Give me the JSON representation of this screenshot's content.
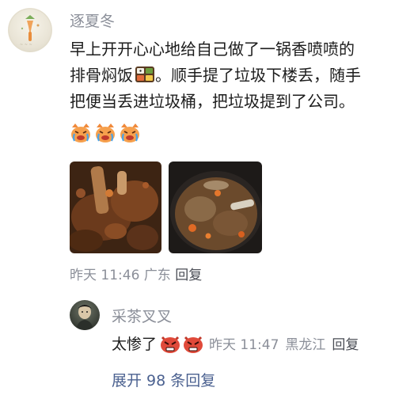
{
  "comment": {
    "username": "逐夏冬",
    "text_line1": "早上开开心心地给自己做了一锅香喷喷的",
    "text_line2_a": "排骨焖饭",
    "text_line2_b": "。顺手提了垃圾下楼丢，随手",
    "text_line3": "把便当丢进垃圾桶，把垃圾提到了公司。",
    "emojis": [
      "crying-cat-emoji",
      "crying-cat-emoji",
      "crying-cat-emoji"
    ],
    "photos": [
      "rib-stew-photo-1",
      "rib-stew-photo-2"
    ],
    "time": "昨天 11:46",
    "location": "广东",
    "reply_label": "回复"
  },
  "reply": {
    "username": "采茶叉叉",
    "text": "太惨了",
    "emojis": [
      "angry-face-emoji",
      "angry-face-emoji"
    ],
    "time": "昨天 11:47",
    "location": "黑龙江",
    "reply_label": "回复"
  },
  "expand_label": "展开 98 条回复",
  "colors": {
    "meta_gray": "#8b8f99",
    "link_blue": "#4b6190",
    "text": "#1c1c1c"
  }
}
